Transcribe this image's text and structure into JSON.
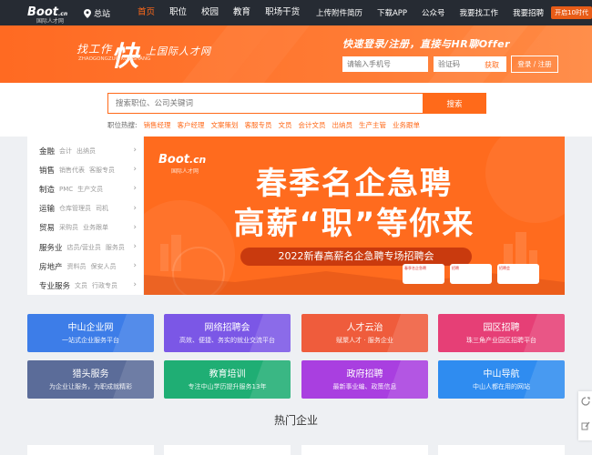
{
  "nav": {
    "logo_mark": "Boot",
    "logo_cn": ".cn",
    "logo_sub": "国际人才网",
    "location": "总站",
    "links": [
      "首页",
      "职位",
      "校园",
      "教育",
      "职场干货"
    ],
    "right_links": [
      "上传附件简历",
      "下载APP",
      "公众号",
      "我要找工作",
      "我要招聘"
    ],
    "badge": "开启10时代"
  },
  "hero": {
    "slogan_a": "找工作",
    "slogan_big": "快",
    "slogan_b": "上国际人才网",
    "slogan_small": "ZHAOGONGZUO KUAISHANG",
    "tagline": "快速登录/注册，直接与HR聊Offer",
    "phone_placeholder": "请输入手机号",
    "code_placeholder": "验证码",
    "get_code": "获取",
    "login_button": "登录 / 注册"
  },
  "search": {
    "placeholder": "搜索职位、公司关键词",
    "button": "搜索",
    "hot_label": "职位热搜:",
    "hot_tags": [
      "销售经理",
      "客户经理",
      "文案策划",
      "客服专员",
      "文员",
      "会计文员",
      "出纳员",
      "生产主管",
      "业务跟单"
    ]
  },
  "sidebar": {
    "items": [
      {
        "name": "金融",
        "subs": [
          "会计",
          "出纳员"
        ]
      },
      {
        "name": "销售",
        "subs": [
          "销售代表",
          "客服专员"
        ]
      },
      {
        "name": "制造",
        "subs": [
          "PMC",
          "生产文员"
        ]
      },
      {
        "name": "运输",
        "subs": [
          "仓库管理员",
          "司机"
        ]
      },
      {
        "name": "贸易",
        "subs": [
          "采购员",
          "业务跟单"
        ]
      },
      {
        "name": "服务业",
        "subs": [
          "店员/营业员",
          "服务员"
        ]
      },
      {
        "name": "房地产",
        "subs": [
          "资料员",
          "保安人员"
        ]
      },
      {
        "name": "专业服务",
        "subs": [
          "文员",
          "行政专员"
        ]
      }
    ]
  },
  "banner": {
    "logo_mark": "Boot",
    "logo_cn": ".cn",
    "logo_sub": "国际人才网",
    "title_line1": "春季名企急聘",
    "title_line2": "高薪“职”等你来",
    "event": "2022新春高薪名企急聘专场招聘会",
    "mini_labels": [
      "春季名企急聘",
      "招聘",
      "招聘会"
    ]
  },
  "tiles": [
    {
      "title": "中山企业网",
      "sub": "一站式企业服务平台",
      "color": "#3d7de8"
    },
    {
      "title": "网络招聘会",
      "sub": "高效、便捷、务实的就业交流平台",
      "color": "#7b57e6"
    },
    {
      "title": "人才云治",
      "sub": "赋聚人才 · 服务企业",
      "color": "#ef5c3c"
    },
    {
      "title": "园区招聘",
      "sub": "珠三角产业园区招聘平台",
      "color": "#e63f76"
    },
    {
      "title": "猎头服务",
      "sub": "为企业让服务，为职成就精彩",
      "color": "#5b6c99"
    },
    {
      "title": "教育培训",
      "sub": "专注中山学历提升服务13年",
      "color": "#1fae74"
    },
    {
      "title": "政府招聘",
      "sub": "最新事业编、政策信息",
      "color": "#a93fe0"
    },
    {
      "title": "中山导航",
      "sub": "中山人都在用的网站",
      "color": "#2f8cf0"
    }
  ],
  "hot_companies": "热门企业",
  "icons": [
    "location-pin-icon",
    "chevron-right-icon",
    "feedback-icon",
    "edit-icon"
  ]
}
